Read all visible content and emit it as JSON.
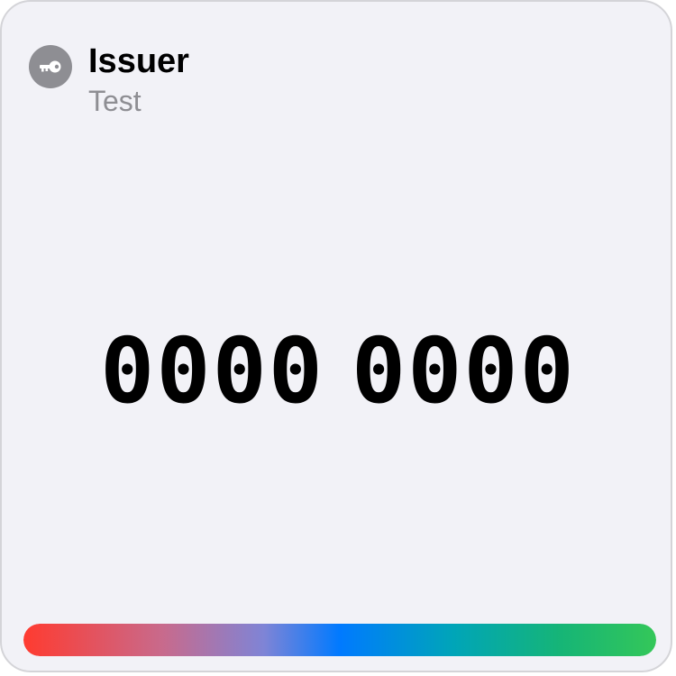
{
  "issuer": {
    "name": "Issuer",
    "account": "Test",
    "icon": "key-icon",
    "icon_bg": "#8e8e93"
  },
  "code": {
    "group1": "0000",
    "group2": "0000"
  },
  "timer": {
    "progress": 1.0,
    "colors": [
      "#ff3b30",
      "#007aff",
      "#34c759"
    ]
  }
}
